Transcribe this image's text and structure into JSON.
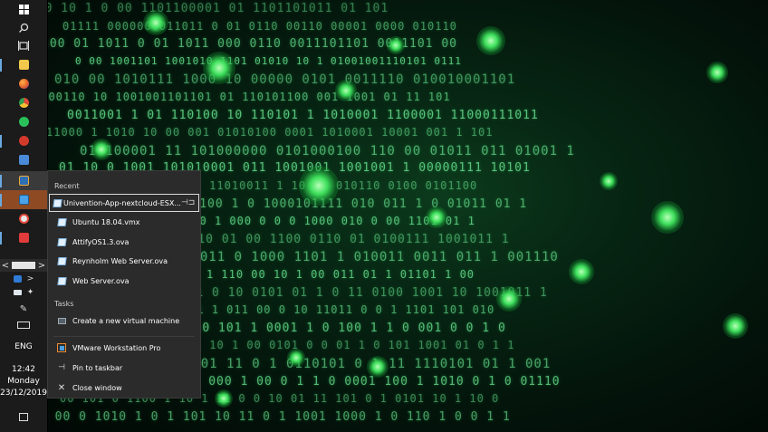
{
  "jump_list": {
    "recent_header": "Recent",
    "recent_items": [
      {
        "label": "Univention-App-nextcloud-ESX...",
        "icon": "vm-file-icon",
        "focused": true
      },
      {
        "label": "Ubuntu 18.04.vmx",
        "icon": "vm-file-icon",
        "focused": false
      },
      {
        "label": "AttifyOS1.3.ova",
        "icon": "vm-file-icon",
        "focused": false
      },
      {
        "label": "Reynholm Web Server.ova",
        "icon": "vm-file-icon",
        "focused": false
      },
      {
        "label": "Web Server.ova",
        "icon": "vm-file-icon",
        "focused": false
      }
    ],
    "pin_glyph": "⊣⊐",
    "tasks_header": "Tasks",
    "task_items": [
      {
        "label": "Create a new virtual machine",
        "icon": "new-vm-icon"
      }
    ],
    "app_label": "VMware Workstation Pro",
    "pin_label": "Pin to taskbar",
    "close_label": "Close window"
  },
  "taskbar": {
    "language": "ENG",
    "time": "12:42",
    "day": "Monday",
    "date": "23/12/2019",
    "icons": [
      {
        "name": "start-icon",
        "color": "#ffffff"
      },
      {
        "name": "search-icon",
        "color": "#d9d9d9"
      },
      {
        "name": "task-view-icon",
        "color": "#d9d9d9"
      },
      {
        "name": "file-explorer-icon",
        "color": "#f2c94c"
      },
      {
        "name": "firefox-icon",
        "color": "#e8622b"
      },
      {
        "name": "chrome-icon",
        "color": "#e04a3b"
      },
      {
        "name": "green-app-icon",
        "color": "#2bbf5a"
      },
      {
        "name": "red-app-icon",
        "color": "#d23a2c"
      },
      {
        "name": "twitch-icon",
        "color": "#4a8ad8"
      },
      {
        "name": "virtualbox-icon",
        "color": "#f0a93a"
      },
      {
        "name": "vmware-icon",
        "color": "#4aa3e8"
      },
      {
        "name": "media-icon",
        "color": "#e6e6e6"
      },
      {
        "name": "anydesk-icon",
        "color": "#e23b3b"
      }
    ]
  },
  "wallpaper": {
    "rows": [
      "110   10   1 0   00   1101100001   01   1101101011   01  101",
      "01111 0000000011011  0  01  0110  00110 00001 0000  010110",
      "100  01  1011 0 01 1011 000 0110  0011101101   0011101  00",
      "0  00 1001101 1001010 1101 01010 10 1  01001001110101 0111",
      "010 00 1010111 1000  10 00000  0101  0011110  010010001101",
      "0000110 10  1001001101101 01 110101100  001  1001  01 11 101",
      "0011001 1 01 110100 10 110101 1  1010001 1100001 11000111011",
      "11000 1 1010 10 00 001 01010100 0001 1010001 10001 001 1 101",
      "01 100001 11 101000000 0101000100  110 00 01011 011  01001 1",
      "01 10 0 1001 101010001  011 1001001 1001001 1 00000111 10101",
      "00 10  10 0110 10 1 1 1 11010011 1  10 00 010110 0100 0101100",
      "00 00110 110 100100 1  0  1000101111  010 011 1 0 01011  01 1",
      "100 0011  1  11  010 0 0 1  000 0 0 0 1000 010 0 00 1101 01 1",
      "10 1111011 01010 1 0 10 01 00 1100 0110  01 0100111 1001011 1",
      "1 011 1 001101 1011 0 1000 1101 1  010011  0011 011 1 001110",
      "11 01 0101  10 01 11 1 1  110 00 10  1 00 011 01 1 01101 1 00",
      "11 0 1100 101 11 0 10 0101 01  1 0 11 0100 1001 10 1001011 1",
      "0 111 0110 1001  1  11 1 011 00 0 10 11011 0 0 1 1101 101 010",
      "010 0 011011 0 1001 10 101 1  0001  1 0 100 1 1 0 001 0 0 1 0",
      "10 1 1 01100 001  1 10 1 00 0101 0 0 01 1 0 101 1001 01 0 1 1",
      "0 11100 01  0 011 101 11 0 1 0110101 0 1 11 1110101 01 1 001",
      "1100  011 1011 1 000 1 00 0 1 1 0 0001 100 1 1010 0 1 0 01110",
      "00  101 0 1100 1 10 1 11 0 0 10 01 11 101 0 1 0101 10 1 10 0",
      "1 00  0 1010 1 0 1 101 10 11 0 1 1001 1000 1 0 110 1 0 0 1 1"
    ]
  }
}
